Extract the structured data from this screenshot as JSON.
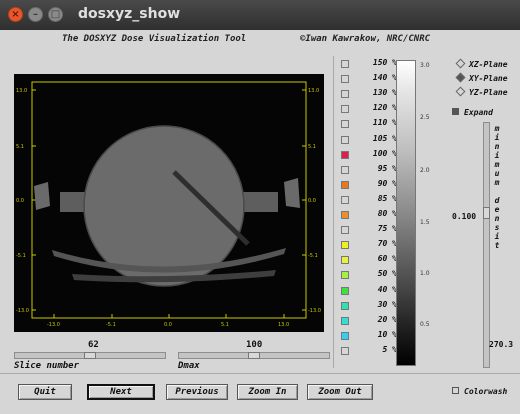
{
  "window": {
    "title": "dosxyz_show"
  },
  "header": {
    "tool_name": "The DOSXYZ Dose Visualization Tool",
    "author": "©Iwan Kawrakow, NRC/CNRC"
  },
  "plot": {
    "left_ticks": [
      "13.0",
      "5.1",
      "0.0",
      "-5.1",
      "-13.0"
    ],
    "right_ticks": [
      "13.0",
      "5.1",
      "0.0",
      "-5.1",
      "-13.0"
    ],
    "bottom_ticks": [
      "-13.0",
      "-5.1",
      "0.0",
      "5.1",
      "13.0"
    ]
  },
  "sliders": {
    "slice": {
      "value": "62",
      "label": "Slice number",
      "level": 0.5
    },
    "dmax": {
      "value": "100",
      "label": "Dmax",
      "level": 0.5
    }
  },
  "buttons": {
    "quit": "Quit",
    "next": "Next",
    "previous": "Previous",
    "zoom_in": "Zoom In",
    "zoom_out": "Zoom Out"
  },
  "legend": [
    {
      "label": "150 %",
      "color": "#d6d6d6"
    },
    {
      "label": "140 %",
      "color": "#d6d6d6"
    },
    {
      "label": "130 %",
      "color": "#d6d6d6"
    },
    {
      "label": "120 %",
      "color": "#d6d6d6"
    },
    {
      "label": "110 %",
      "color": "#d6d6d6"
    },
    {
      "label": "105 %",
      "color": "#d6d6d6"
    },
    {
      "label": "100 %",
      "color": "#e0204a"
    },
    {
      "label": "95 %",
      "color": "#d6d6d6"
    },
    {
      "label": "90 %",
      "color": "#e87820"
    },
    {
      "label": "85 %",
      "color": "#d6d6d6"
    },
    {
      "label": "80 %",
      "color": "#e89030"
    },
    {
      "label": "75 %",
      "color": "#d6d6d6"
    },
    {
      "label": "70 %",
      "color": "#f0f020"
    },
    {
      "label": "60 %",
      "color": "#e8f040"
    },
    {
      "label": "50 %",
      "color": "#a8f040"
    },
    {
      "label": "40 %",
      "color": "#40e040"
    },
    {
      "label": "30 %",
      "color": "#30e0b0"
    },
    {
      "label": "20 %",
      "color": "#30e0d0"
    },
    {
      "label": "10 %",
      "color": "#30d0f0"
    },
    {
      "label": "5 %",
      "color": "#d6d6d6"
    }
  ],
  "density_bar": {
    "ticks": [
      "3.0",
      "2.5",
      "2.0",
      "1.5",
      "1.0",
      "0.5"
    ]
  },
  "planes": {
    "xz": {
      "label": "XZ-Plane",
      "selected": false
    },
    "xy": {
      "label": "XY-Plane",
      "selected": true
    },
    "yz": {
      "label": "YZ-Plane",
      "selected": false
    }
  },
  "expand": {
    "label": "Expand",
    "checked": true
  },
  "min_density": {
    "label_letters": [
      "m",
      "i",
      "n",
      "i",
      "m",
      "u",
      "m",
      "",
      "d",
      "e",
      "n",
      "s",
      "i",
      "t"
    ],
    "value": "0.100",
    "bottom_value": "270.3"
  },
  "colorwash": {
    "label": "Colorwash",
    "checked": false
  }
}
